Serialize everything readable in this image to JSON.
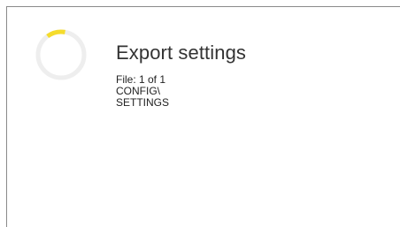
{
  "dialog": {
    "title": "Export settings",
    "file_progress": "File: 1 of 1",
    "path_line1": "CONFIG\\",
    "path_line2": "SETTINGS"
  },
  "spinner": {
    "icon": "loading-spinner-icon",
    "track_color": "#eeeeee",
    "accent_color": "#f5dc2c"
  }
}
